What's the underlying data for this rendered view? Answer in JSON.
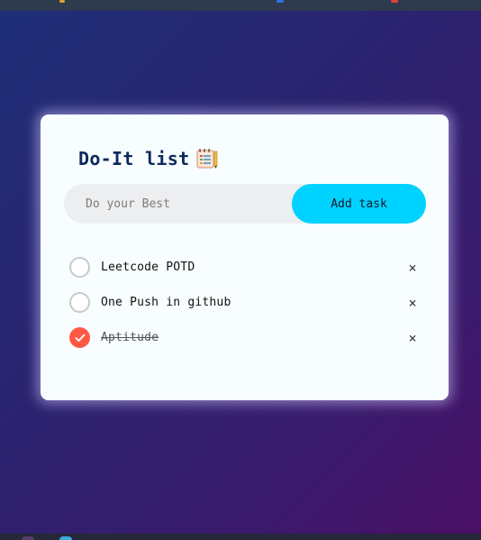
{
  "app": {
    "title": "Do-It list",
    "title_icon": "notepad-icon"
  },
  "input": {
    "placeholder": "Do your Best",
    "value": "",
    "add_label": "Add task"
  },
  "tasks": [
    {
      "label": "Leetcode POTD",
      "done": false
    },
    {
      "label": "One Push in github",
      "done": false
    },
    {
      "label": "Aptitude",
      "done": true
    }
  ],
  "actions": {
    "delete_symbol": "×"
  },
  "colors": {
    "accent_button": "#00d2ff",
    "checked": "#ff5945",
    "title": "#0c2a5c",
    "card": "#f8feff"
  }
}
